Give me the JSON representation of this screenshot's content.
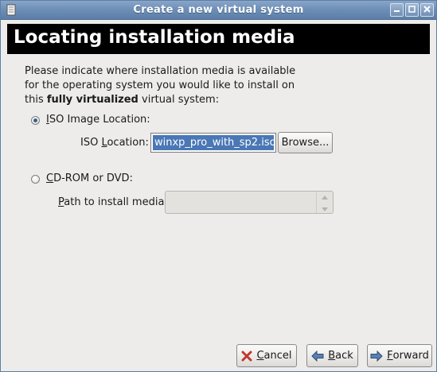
{
  "window": {
    "title": "Create a new virtual system"
  },
  "header": {
    "title": "Locating installation media"
  },
  "description": {
    "line1": "Please indicate where installation media is available",
    "line2": "for the operating system you would like to install on",
    "line3_prefix": "this ",
    "line3_bold": "fully virtualized",
    "line3_suffix": " virtual system:"
  },
  "iso_option": {
    "label_mnemonic": "I",
    "label_rest": "SO Image Location:",
    "selected": true,
    "field_label_prefix": "ISO ",
    "field_label_mnemonic": "L",
    "field_label_rest": "ocation:",
    "value": "winxp_pro_with_sp2.iso",
    "browse_label": "Browse..."
  },
  "cdrom_option": {
    "label_mnemonic": "C",
    "label_rest": "D-ROM or DVD:",
    "selected": false,
    "path_label_mnemonic": "P",
    "path_label_rest": "ath to install media:",
    "path_value": ""
  },
  "buttons": {
    "cancel_mnemonic": "C",
    "cancel_rest": "ancel",
    "back_mnemonic": "B",
    "back_rest": "ack",
    "forward_mnemonic": "F",
    "forward_rest": "orward"
  },
  "icons": {
    "title": "window-menu-icon",
    "minimize": "minimize-icon",
    "maximize": "maximize-icon",
    "close": "close-icon",
    "cancel": "cancel-x-icon",
    "back": "back-arrow-icon",
    "forward": "forward-arrow-icon"
  },
  "colors": {
    "titlebar": "#6e8fb8",
    "header_bg": "#000000",
    "selection": "#4a77b5",
    "cancel_icon": "#c0392b",
    "arrow_icon": "#3b5f8c"
  }
}
